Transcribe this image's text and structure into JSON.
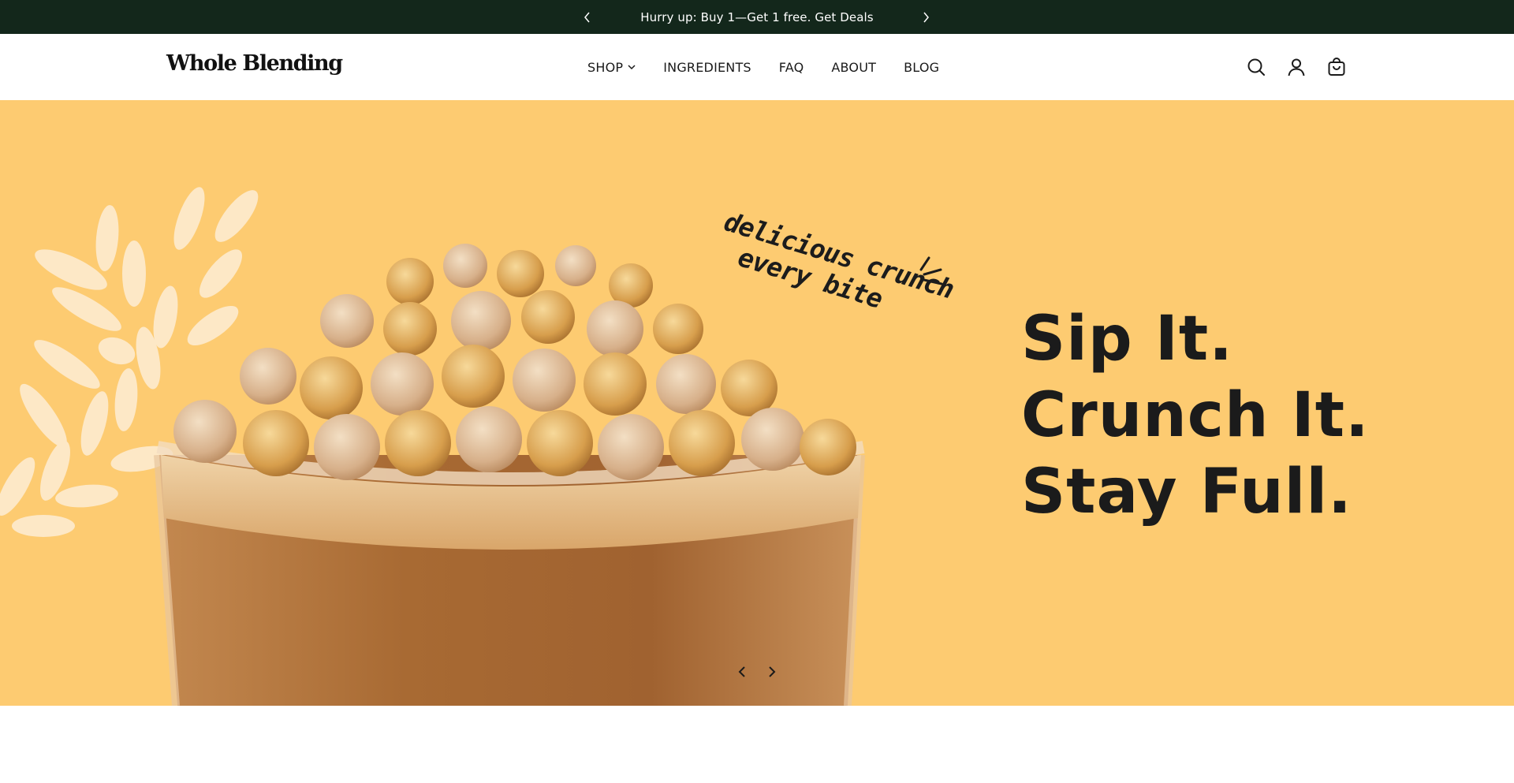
{
  "announcement": {
    "text": "Hurry up: Buy 1—Get 1 free. Get Deals",
    "prev_icon": "chevron-left-icon",
    "next_icon": "chevron-right-icon"
  },
  "header": {
    "logo": "Whole Blending",
    "nav": [
      {
        "label": "SHOP",
        "has_dropdown": true
      },
      {
        "label": "INGREDIENTS"
      },
      {
        "label": "FAQ"
      },
      {
        "label": "ABOUT"
      },
      {
        "label": "BLOG"
      }
    ],
    "icons": [
      "search-icon",
      "account-icon",
      "cart-icon"
    ]
  },
  "hero": {
    "tagline_line1": "delicious crunch",
    "tagline_line2": "every bite",
    "headline": [
      "Sip It.",
      "Crunch It.",
      "Stay Full."
    ],
    "prev_icon": "chevron-left-icon",
    "next_icon": "chevron-right-icon",
    "image": "smoothie-glass-with-puffed-cereal-image"
  },
  "colors": {
    "announcement_bg": "#13271b",
    "hero_bg": "#fdcb71",
    "leaf": "#fde8c6",
    "text_dark": "#1b1b1b"
  }
}
